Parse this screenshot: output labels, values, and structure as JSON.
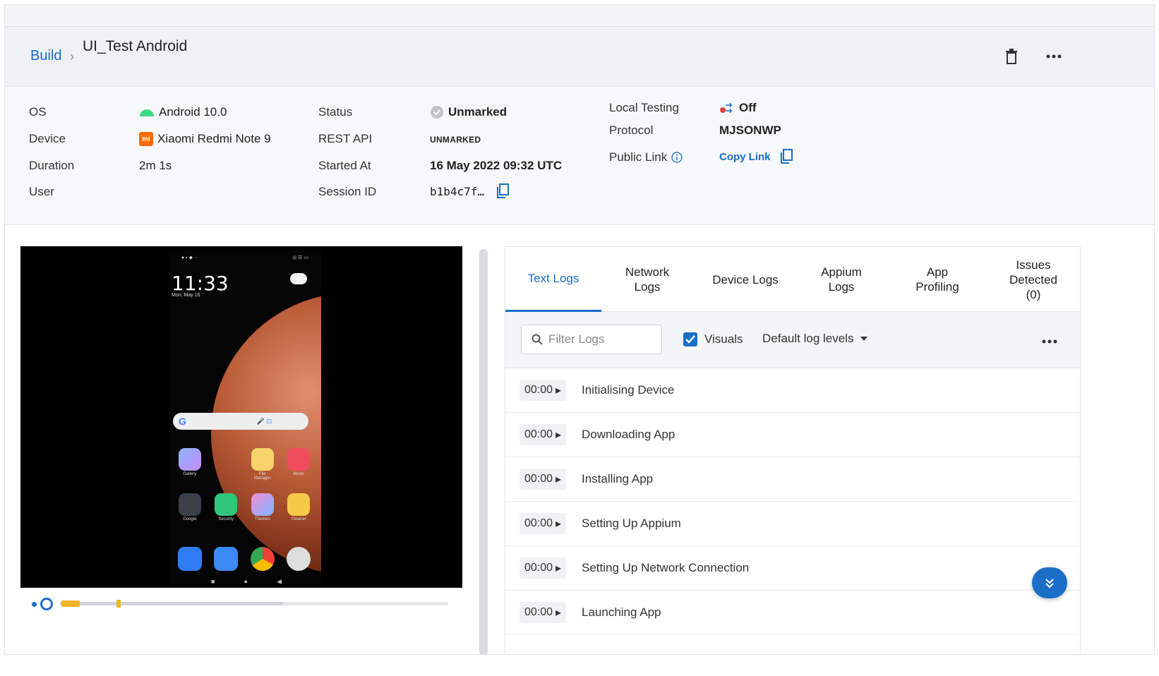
{
  "header": {
    "breadcrumb": "Build",
    "title": "UI_Test Android",
    "delete_icon": "trash-icon",
    "more_icon": "more-horizontal-icon"
  },
  "info": {
    "os_label": "OS",
    "os_value": "Android 10.0",
    "device_label": "Device",
    "device_value": "Xiaomi Redmi Note 9",
    "duration_label": "Duration",
    "duration_value": "2m 1s",
    "user_label": "User",
    "status_label": "Status",
    "status_value": "Unmarked",
    "rest_label": "REST API",
    "rest_value": "UNMARKED",
    "started_label": "Started At",
    "started_value": "16 May 2022 09:32 UTC",
    "session_label": "Session ID",
    "session_value": "b1b4c7f…",
    "local_label": "Local Testing",
    "local_value": "Off",
    "protocol_label": "Protocol",
    "protocol_value": "MJSONWP",
    "public_label": "Public Link",
    "public_value": "Copy Link"
  },
  "phone": {
    "clock": "11:33",
    "date": "Mon, May 16",
    "apps_row1": [
      "Gallery",
      "File Manager",
      "Music"
    ],
    "apps_row2": [
      "Google",
      "Security",
      "Themes",
      "Cleaner"
    ]
  },
  "tabs": [
    {
      "label": "Text Logs"
    },
    {
      "label": "Network Logs"
    },
    {
      "label": "Device Logs"
    },
    {
      "label": "Appium Logs"
    },
    {
      "label": "App Profiling"
    },
    {
      "label": "Issues Detected (0)"
    }
  ],
  "toolbar": {
    "filter_placeholder": "Filter Logs",
    "visuals_label": "Visuals",
    "levels_label": "Default log levels"
  },
  "logs": [
    {
      "time": "00:00",
      "text": "Initialising Device"
    },
    {
      "time": "00:00",
      "text": "Downloading App"
    },
    {
      "time": "00:00",
      "text": "Installing App"
    },
    {
      "time": "00:00",
      "text": "Setting Up Appium"
    },
    {
      "time": "00:00",
      "text": "Setting Up Network Connection"
    },
    {
      "time": "00:00",
      "text": "Launching App"
    }
  ],
  "colors": {
    "accent": "#1a6ec8",
    "seek": "#f0b429"
  }
}
